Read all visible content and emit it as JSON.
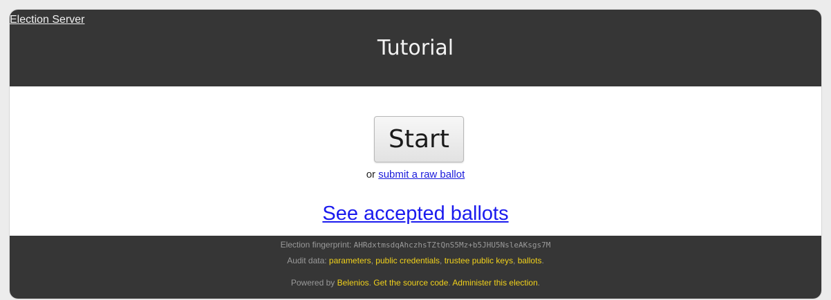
{
  "header": {
    "server_link": "Election Server",
    "title": "Tutorial"
  },
  "main": {
    "start_button": "Start",
    "raw_prefix": "or",
    "raw_link": "submit a raw ballot",
    "accepted_link": "See accepted ballots"
  },
  "footer": {
    "fingerprint_label": "Election fingerprint:",
    "fingerprint_value": "AHRdxtmsdqAhczhsTZtQnS5Mz+b5JHU5NsleAKsgs7M",
    "audit_label": "Audit data:",
    "audit_links": [
      "parameters",
      "public credentials",
      "trustee public keys",
      "ballots"
    ],
    "powered_label": "Powered by",
    "powered_link": "Belenios",
    "source_link": "Get the source code",
    "admin_link": "Administer this election"
  },
  "colors": {
    "bar_background": "#363636",
    "footer_link": "#f2d21b",
    "main_link": "#1a1aee"
  }
}
